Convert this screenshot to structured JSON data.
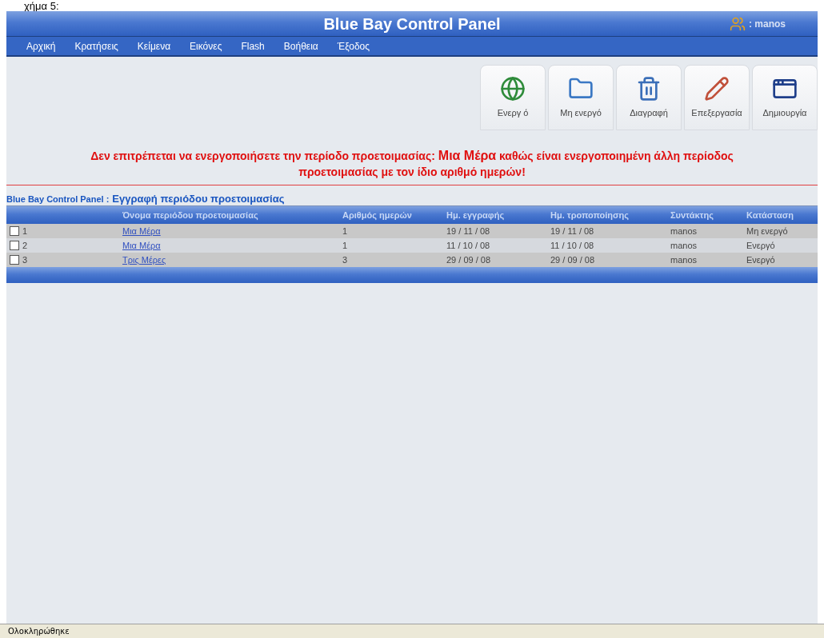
{
  "caption": "χήμα 5:",
  "header": {
    "title": "Blue Bay Control Panel",
    "user": ": manos"
  },
  "nav": [
    "Αρχική",
    "Κρατήσεις",
    "Κείμενα",
    "Εικόνες",
    "Flash",
    "Βοήθεια",
    "Έξοδος"
  ],
  "toolbar": [
    {
      "kind": "activate",
      "label": "Ενεργ ό"
    },
    {
      "kind": "deactivate",
      "label": "Μη ενεργό"
    },
    {
      "kind": "delete",
      "label": "Διαγραφή"
    },
    {
      "kind": "edit",
      "label": "Επεξεργασία"
    },
    {
      "kind": "create",
      "label": "Δημιουργία"
    }
  ],
  "message": "Δεν επιτρέπεται να ενεργοποιήσετε την περίοδο προετοιμασίας: **Μια Μέρα** καθώς είναι ενεργοποιημένη άλλη περίοδος προετοιμασίας με τον ίδιο αριθμό ημερών!",
  "section": {
    "app": "Blue Bay Control Panel :",
    "title": "Εγγραφή περιόδου προετοιμασίας"
  },
  "table": {
    "columns": [
      "Όνομα περιόδου προετοιμασίας",
      "Αριθμός ημερών",
      "Ημ. εγγραφής",
      "Ημ. τροποποίησης",
      "Συντάκτης",
      "Κατάσταση"
    ],
    "rows": [
      {
        "checked": false,
        "index": "1",
        "name": "Μια Μέρα",
        "days": "1",
        "created": "19 / 11 / 08",
        "modified": "19 / 11 / 08",
        "editor": "manos",
        "status": "Μη ενεργό"
      },
      {
        "checked": false,
        "index": "2",
        "name": "Μια Μέρα",
        "days": "1",
        "created": "11 / 10 / 08",
        "modified": "11 / 10 / 08",
        "editor": "manos",
        "status": "Ενεργό"
      },
      {
        "checked": false,
        "index": "3",
        "name": "Τρις Μέρες",
        "days": "3",
        "created": "29 / 09 / 08",
        "modified": "29 / 09 / 08",
        "editor": "manos",
        "status": "Ενεργό"
      }
    ]
  },
  "status_bar": "Ολοκληρώθηκε"
}
